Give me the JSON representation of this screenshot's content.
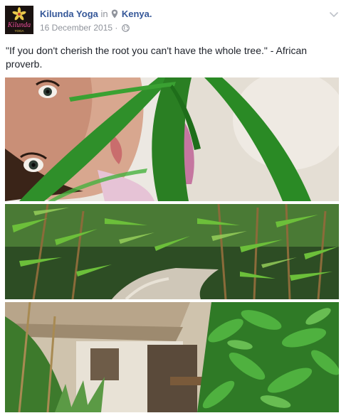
{
  "post": {
    "page_name": "Kilunda Yoga",
    "in_word": "in",
    "location": "Kenya.",
    "date": "16 December 2015",
    "separator": "·",
    "text": "\"If you don't cherish the root you can't have the whole tree.\" - African proverb."
  },
  "avatar": {
    "brand_text": "Kilunda",
    "sub_text": "YOGA"
  },
  "icons": {
    "privacy": "globe-icon",
    "location": "location-pin-icon",
    "options": "chevron-down-icon"
  },
  "colors": {
    "link": "#365899",
    "meta": "#90949c",
    "avatar_bg": "#1a1210",
    "avatar_flower": "#e8c84a",
    "leaf_green": "#2f8f2a"
  }
}
